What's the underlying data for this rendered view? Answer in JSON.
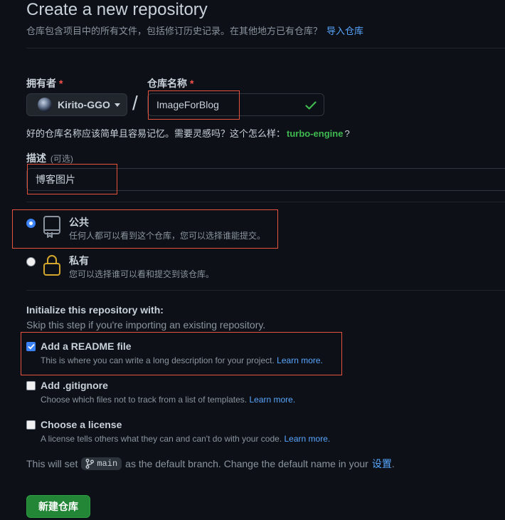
{
  "header": {
    "title": "Create a new repository",
    "subtitle": "仓库包含项目中的所有文件，包括修订历史记录。在其他地方已有仓库？",
    "import_link": "导入仓库"
  },
  "owner": {
    "label": "拥有者",
    "required_mark": "*",
    "value": "Kirito-GGO"
  },
  "separator": "/",
  "repo_name": {
    "label": "仓库名称",
    "required_mark": "*",
    "value": "ImageForBlog"
  },
  "name_hint": {
    "text": "好的仓库名称应该简单且容易记忆。需要灵感吗？这个怎么样：",
    "suggestion": "turbo-engine",
    "suffix": "?"
  },
  "description": {
    "label": "描述",
    "optional": "(可选)",
    "value": "博客图片"
  },
  "visibility": {
    "public": {
      "title": "公共",
      "desc": "任何人都可以看到这个仓库，您可以选择谁能提交。",
      "selected": true
    },
    "private": {
      "title": "私有",
      "desc": "您可以选择谁可以看和提交到该仓库。",
      "selected": false
    }
  },
  "init": {
    "title": "Initialize this repository with:",
    "subtitle": "Skip this step if you're importing an existing repository.",
    "readme": {
      "title": "Add a README file",
      "desc": "This is where you can write a long description for your project.",
      "link": "Learn more.",
      "checked": true
    },
    "gitignore": {
      "title": "Add .gitignore",
      "desc": "Choose which files not to track from a list of templates.",
      "link": "Learn more.",
      "checked": false
    },
    "license": {
      "title": "Choose a license",
      "desc": "A license tells others what they can and can't do with your code.",
      "link": "Learn more.",
      "checked": false
    }
  },
  "branch_note": {
    "prefix": "This will set",
    "branch": "main",
    "middle": "as the default branch. Change the default name in your",
    "link": "设置",
    "suffix": "."
  },
  "create_button": "新建仓库",
  "colors": {
    "background": "#0d1117",
    "accent_link": "#58a6ff",
    "success_green": "#3fb950",
    "button_green": "#238636",
    "highlight_red": "#e5533c"
  }
}
